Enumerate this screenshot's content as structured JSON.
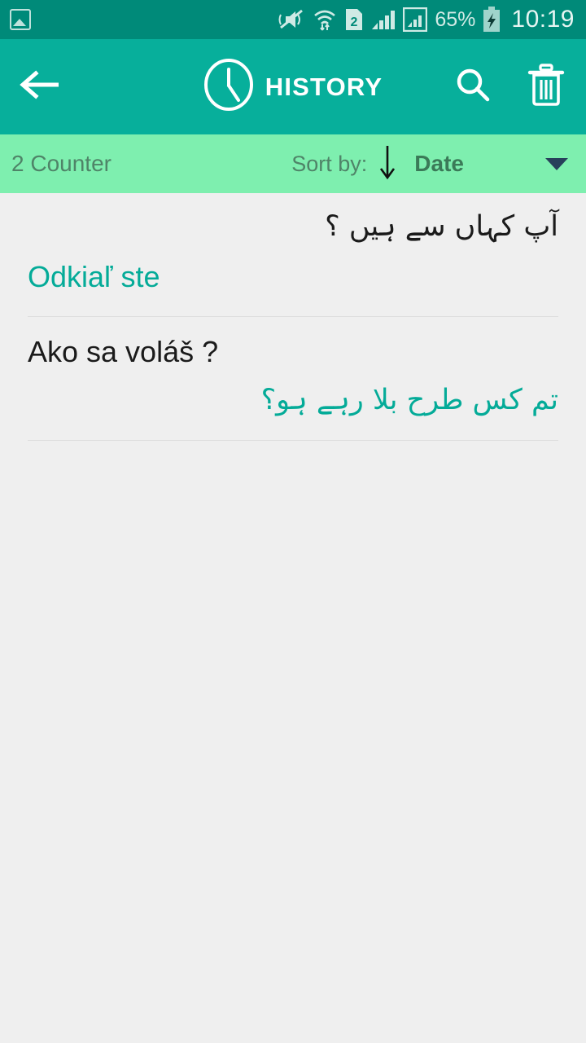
{
  "status_bar": {
    "background": "#008a79",
    "left_icons": [
      {
        "name": "photo-screenshot-icon",
        "glyph": "image"
      }
    ],
    "right_icons": [
      {
        "name": "vibrate-mute-icon",
        "glyph": "mute"
      },
      {
        "name": "wifi-data-icon",
        "glyph": "wifi"
      },
      {
        "name": "sim2-icon",
        "glyph": "2"
      },
      {
        "name": "signal-bars-sim1-icon",
        "glyph": "bars"
      },
      {
        "name": "signal-bars-sim2-icon",
        "glyph": "bars-boxed"
      }
    ],
    "battery_percent": "65%",
    "battery_charging": true,
    "time": "10:19"
  },
  "app_bar": {
    "background": "#07af9b",
    "back_label": "back-arrow",
    "clock_icon": "clock-icon",
    "title": "HISTORY",
    "actions": [
      {
        "name": "search-icon",
        "label": "Search"
      },
      {
        "name": "delete-icon",
        "label": "Delete"
      }
    ]
  },
  "sort_bar": {
    "background": "#7eefaf",
    "counter_text": "2 Counter",
    "sort_by_label": "Sort by:",
    "sort_direction": "descending",
    "sort_value": "Date",
    "dropdown_icon": "chevron-down-icon"
  },
  "history": {
    "items": [
      {
        "source_text": "آپ کہاں سے ہیں ؟",
        "source_dir": "rtl",
        "source_color": "dark",
        "target_text": "Odkiaľ ste",
        "target_dir": "ltr",
        "target_color": "teal"
      },
      {
        "source_text": "Ako sa voláš ?",
        "source_dir": "ltr",
        "source_color": "dark",
        "target_text": "تم کس طرح بلا رہے ہو؟",
        "target_dir": "rtl",
        "target_color": "teal"
      }
    ]
  },
  "colors": {
    "status_bar": "#008a79",
    "app_bar": "#07af9b",
    "sort_bar": "#7eefaf",
    "body": "#efefef",
    "accent_teal": "#04ab98",
    "text_dark": "#1b1b1b"
  }
}
